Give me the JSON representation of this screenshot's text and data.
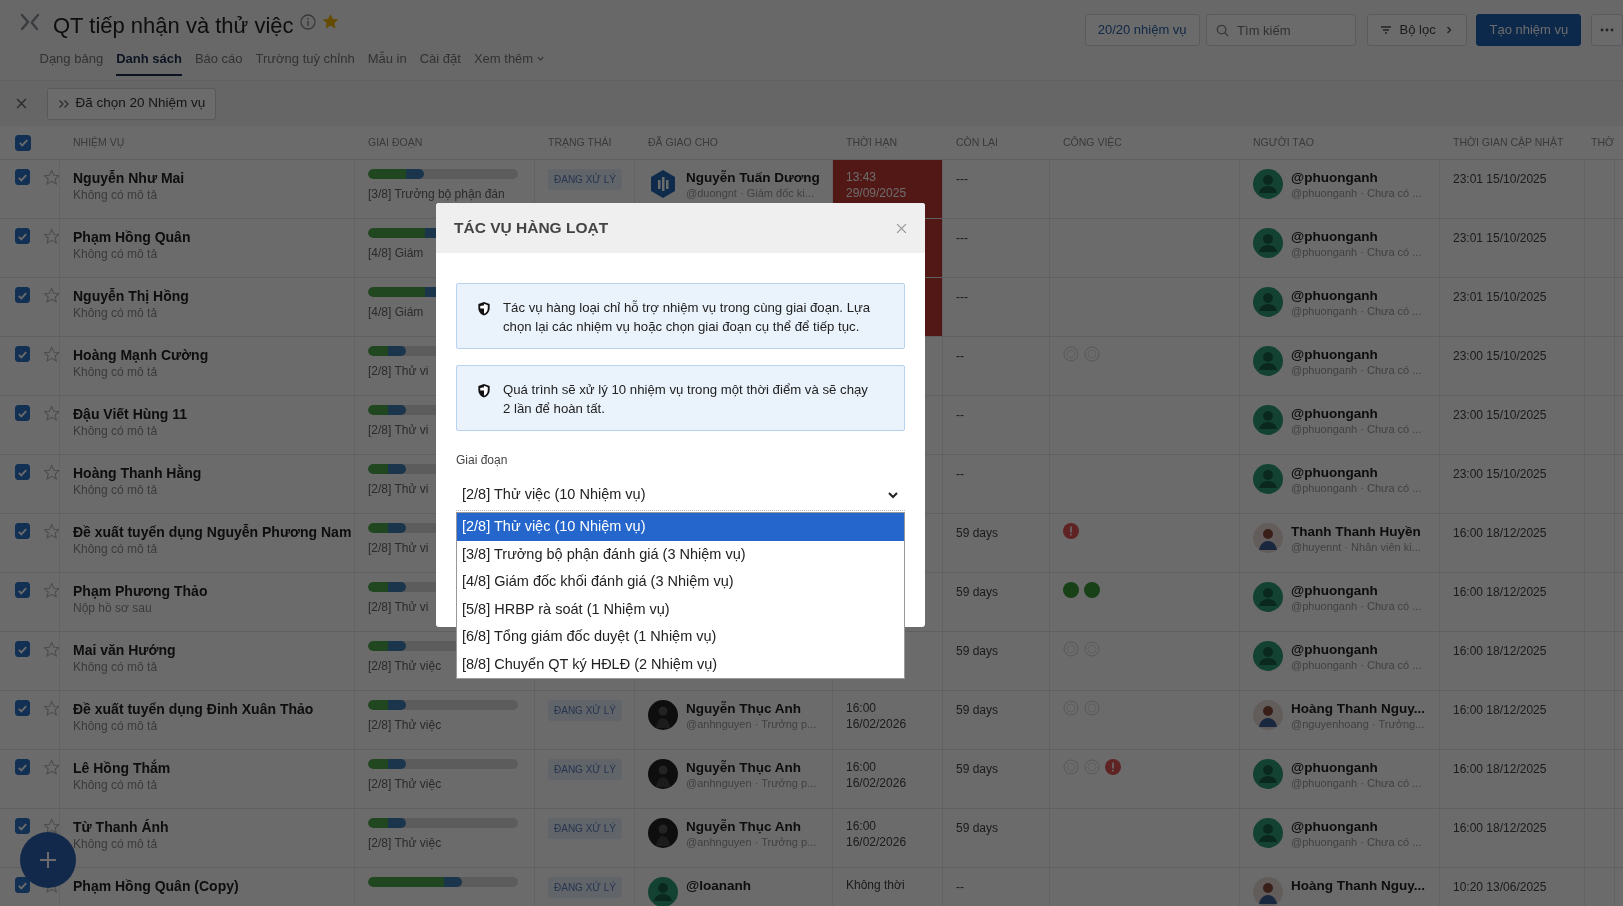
{
  "header": {
    "title": "QT tiếp nhận và thử việc",
    "favorite": true,
    "tabs": [
      {
        "label": "Dạng bảng",
        "selected": false,
        "kind": "link"
      },
      {
        "label": "Danh sách",
        "selected": true,
        "kind": "link"
      },
      {
        "label": "Báo cáo",
        "selected": false,
        "kind": "link"
      },
      {
        "label": "Trường tuỳ chỉnh",
        "selected": false,
        "kind": "link"
      },
      {
        "label": "Mẫu in",
        "selected": false,
        "kind": "link"
      },
      {
        "label": "Cài đặt",
        "selected": false,
        "kind": "link"
      },
      {
        "label": "Xem thêm",
        "selected": false,
        "kind": "dropdown"
      }
    ],
    "count_button": "20/20 nhiệm vụ",
    "search": {
      "placeholder": "Tìm kiếm"
    },
    "filter_button": "Bộ lọc",
    "create_button": "Tạo nhiệm vụ"
  },
  "selection_bar": {
    "label": "Đã chọn 20 Nhiệm vụ"
  },
  "table": {
    "all_checked": true,
    "columns": [
      "NHIỆM VỤ",
      "GIAI ĐOẠN",
      "TRẠNG THÁI",
      "ĐÃ GIAO CHO",
      "THỜI HẠN",
      "CÒN LẠI",
      "CÔNG VIỆC",
      "NGƯỜI TẠO",
      "THỜI GIAN CẬP NHẬT",
      "THỜ"
    ],
    "rows": [
      {
        "checked": true,
        "starred": false,
        "name": "Nguyễn Như Mai",
        "description": "Không có mô tả",
        "level": 0.375,
        "stage": "[3/8] Trưởng bộ phận đán",
        "status": "ĐANG XỬ LÝ",
        "assignee": {
          "name": "Nguyễn Tuấn Dương",
          "handle": "@duongnt · Giám đốc ki...",
          "kind": "logo"
        },
        "deadline": {
          "lines": [
            "13:43",
            "29/09/2025"
          ],
          "overdue": true
        },
        "remaining": "---",
        "subtasks": [],
        "creator": {
          "name": "@phuonganh",
          "handle": "@phuonganh · Chưa có ...",
          "kind": "default"
        },
        "updated": "23:01 15/10/2025"
      },
      {
        "checked": true,
        "starred": false,
        "name": "Phạm Hồng Quân",
        "description": "Không có mô tả",
        "level": 0.5,
        "stage": "[4/8] Giám",
        "deadline": {
          "overdue": true
        },
        "remaining": "---",
        "subtasks": [],
        "creator": {
          "name": "@phuonganh",
          "handle": "@phuonganh · Chưa có ...",
          "kind": "default"
        },
        "updated": "23:01 15/10/2025"
      },
      {
        "checked": true,
        "starred": false,
        "name": "Nguyễn Thị Hồng",
        "description": "Không có mô tả",
        "level": 0.5,
        "stage": "[4/8] Giám",
        "deadline": {
          "overdue": true
        },
        "remaining": "---",
        "subtasks": [],
        "creator": {
          "name": "@phuonganh",
          "handle": "@phuonganh · Chưa có ...",
          "kind": "default"
        },
        "updated": "23:01 15/10/2025"
      },
      {
        "checked": true,
        "starred": false,
        "name": "Hoàng Mạnh Cường",
        "description": "Không có mô tả",
        "level": 0.25,
        "stage": "[2/8] Thử vi",
        "remaining": "--",
        "subtasks": [
          {
            "kind": "empty"
          },
          {
            "kind": "empty"
          }
        ],
        "creator": {
          "name": "@phuonganh",
          "handle": "@phuonganh · Chưa có ...",
          "kind": "default"
        },
        "updated": "23:00 15/10/2025"
      },
      {
        "checked": true,
        "starred": false,
        "name": "Đậu Viết Hùng 11",
        "description": "Không có mô tả",
        "level": 0.25,
        "stage": "[2/8] Thử vi",
        "remaining": "--",
        "subtasks": [],
        "creator": {
          "name": "@phuonganh",
          "handle": "@phuonganh · Chưa có ...",
          "kind": "default"
        },
        "updated": "23:00 15/10/2025"
      },
      {
        "checked": true,
        "starred": false,
        "name": "Hoàng Thanh Hằng",
        "description": "Không có mô tả",
        "level": 0.25,
        "stage": "[2/8] Thử vi",
        "remaining": "--",
        "subtasks": [],
        "creator": {
          "name": "@phuonganh",
          "handle": "@phuonganh · Chưa có ...",
          "kind": "default"
        },
        "updated": "23:00 15/10/2025"
      },
      {
        "checked": true,
        "starred": false,
        "name": "Đề xuất tuyển dụng Nguyễn Phương Nam",
        "description": "Không có mô tả",
        "level": 0.25,
        "stage": "[2/8] Thử vi",
        "remaining": "59 days",
        "subtasks": [
          {
            "kind": "alert"
          }
        ],
        "creator": {
          "name": "Thanh Thanh Huyền",
          "handle": "@huyennt · Nhân viên ki...",
          "kind": "photo"
        },
        "updated": "16:00 18/12/2025"
      },
      {
        "checked": true,
        "starred": false,
        "name": "Phạm Phương Thảo",
        "description": "Nộp hồ sơ sau",
        "level": 0.25,
        "stage": "[2/8] Thử vi",
        "remaining": "59 days",
        "subtasks": [
          {
            "kind": "done"
          },
          {
            "kind": "done"
          }
        ],
        "creator": {
          "name": "@phuonganh",
          "handle": "@phuonganh · Chưa có ...",
          "kind": "default"
        },
        "updated": "16:00 18/12/2025"
      },
      {
        "checked": true,
        "starred": false,
        "name": "Mai văn Hướng",
        "description": "Không có mô tả",
        "level": 0.25,
        "stage": "[2/8] Thử việc",
        "remaining": "59 days",
        "subtasks": [
          {
            "kind": "empty"
          },
          {
            "kind": "empty"
          }
        ],
        "creator": {
          "name": "@phuonganh",
          "handle": "@phuonganh · Chưa có ...",
          "kind": "default"
        },
        "updated": "16:00 18/12/2025"
      },
      {
        "checked": true,
        "starred": false,
        "name": "Đề xuất tuyển dụng Đinh Xuân Thảo",
        "description": "Không có mô tả",
        "level": 0.25,
        "stage": "[2/8] Thử việc",
        "status": "ĐANG XỬ LÝ",
        "assignee": {
          "name": "Nguyễn Thục Anh",
          "handle": "@anhnguyen · Trưởng p...",
          "kind": "dark"
        },
        "deadline": {
          "lines": [
            "16:00",
            "16/02/2026"
          ],
          "overdue": false
        },
        "remaining": "59 days",
        "subtasks": [
          {
            "kind": "empty"
          },
          {
            "kind": "empty"
          }
        ],
        "creator": {
          "name": "Hoàng Thanh Nguy...",
          "handle": "@nguyenhoang · Trưởng...",
          "kind": "photo"
        },
        "updated": "16:00 18/12/2025"
      },
      {
        "checked": true,
        "starred": false,
        "name": "Lê Hồng Thắm",
        "description": "Không có mô tả",
        "level": 0.25,
        "stage": "[2/8] Thử việc",
        "status": "ĐANG XỬ LÝ",
        "assignee": {
          "name": "Nguyễn Thục Anh",
          "handle": "@anhnguyen · Trưởng p...",
          "kind": "dark"
        },
        "deadline": {
          "lines": [
            "16:00",
            "16/02/2026"
          ],
          "overdue": false
        },
        "remaining": "59 days",
        "subtasks": [
          {
            "kind": "empty"
          },
          {
            "kind": "empty"
          },
          {
            "kind": "alert"
          }
        ],
        "creator": {
          "name": "@phuonganh",
          "handle": "@phuonganh · Chưa có ...",
          "kind": "default"
        },
        "updated": "16:00 18/12/2025"
      },
      {
        "checked": true,
        "starred": false,
        "name": "Từ Thanh Ánh",
        "description": "Không có mô tả",
        "level": 0.25,
        "stage": "[2/8] Thử việc",
        "status": "ĐANG XỬ LÝ",
        "assignee": {
          "name": "Nguyễn Thục Anh",
          "handle": "@anhnguyen · Trưởng p...",
          "kind": "dark"
        },
        "deadline": {
          "lines": [
            "16:00",
            "16/02/2026"
          ],
          "overdue": false
        },
        "remaining": "59 days",
        "subtasks": [],
        "creator": {
          "name": "@phuonganh",
          "handle": "@phuonganh · Chưa có ...",
          "kind": "default"
        },
        "updated": "16:00 18/12/2025"
      },
      {
        "checked": true,
        "starred": false,
        "name": "Phạm Hồng Quân (Copy)",
        "level": 0.625,
        "status": "ĐANG XỬ LÝ",
        "assignee": {
          "name": "@loananh",
          "kind": "default"
        },
        "deadline": {
          "lines": [
            "Không thời"
          ],
          "overdue": false
        },
        "remaining": "--",
        "subtasks": [],
        "creator": {
          "name": "Hoàng Thanh Nguy...",
          "kind": "photo"
        },
        "updated": "10:20 13/06/2025"
      }
    ]
  },
  "modal": {
    "title": "TÁC VỤ HÀNG LOẠT",
    "alerts": [
      "Tác vụ hàng loại chỉ hỗ trợ nhiệm vụ trong cùng giai đoạn. Lựa chọn lại các nhiệm vụ hoặc chọn giai đoạn cụ thể để tiếp tục.",
      "Quá trình sẽ xử lý 10 nhiệm vụ trong một thời điểm và sẽ chạy 2 lần để hoàn tất."
    ],
    "field_label": "Giai đoạn",
    "select_value": "[2/8] Thử việc (10 Nhiệm vụ)",
    "options": [
      {
        "label": "[2/8] Thử việc (10 Nhiệm vụ)",
        "selected": true
      },
      {
        "label": "[3/8] Trưởng bộ phận đánh giá (3 Nhiệm vụ)",
        "selected": false
      },
      {
        "label": "[4/8] Giám đốc khối đánh giá (3 Nhiệm vụ)",
        "selected": false
      },
      {
        "label": "[5/8] HRBP rà soát (1 Nhiệm vụ)",
        "selected": false
      },
      {
        "label": "[6/8] Tổng giám đốc duyệt (1 Nhiệm vụ)",
        "selected": false
      },
      {
        "label": "[8/8] Chuyển QT ký HĐLĐ (2 Nhiệm vụ)",
        "selected": false
      }
    ]
  }
}
